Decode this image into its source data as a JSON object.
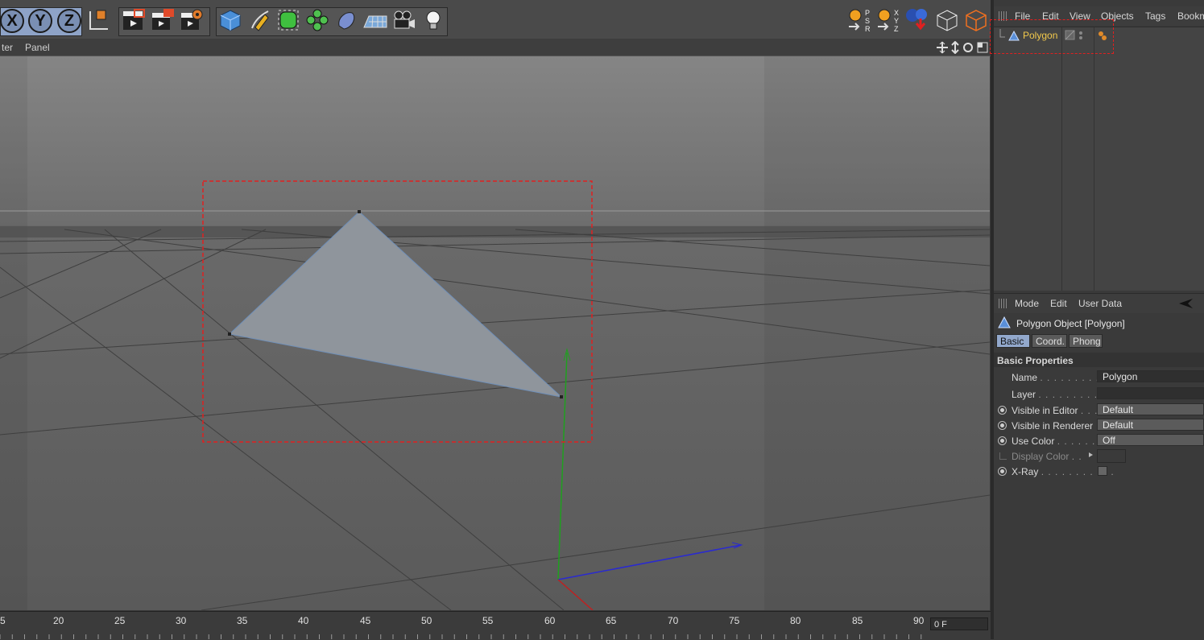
{
  "toolbar": {
    "axis_x": "X",
    "axis_y": "Y",
    "axis_z": "Z",
    "psr_letters": [
      "P",
      "S",
      "R"
    ],
    "xyz_letters": [
      "X",
      "Y",
      "Z"
    ]
  },
  "viewport_menu": {
    "items": [
      "ter",
      "Panel"
    ]
  },
  "object_manager": {
    "menu": [
      "File",
      "Edit",
      "View",
      "Objects",
      "Tags",
      "Bookm"
    ],
    "objects": [
      {
        "name": "Polygon",
        "color": "#f2c94c"
      }
    ]
  },
  "attribute_manager": {
    "menu": [
      "Mode",
      "Edit",
      "User Data"
    ],
    "object_title": "Polygon Object [Polygon]",
    "tabs": [
      {
        "label": "Basic",
        "active": true
      },
      {
        "label": "Coord.",
        "active": false
      },
      {
        "label": "Phong",
        "active": false
      }
    ],
    "section_title": "Basic Properties",
    "properties": {
      "name_label": "Name",
      "name_value": "Polygon",
      "layer_label": "Layer",
      "layer_value": "",
      "vis_editor_label": "Visible in Editor",
      "vis_editor_value": "Default",
      "vis_renderer_label": "Visible in Renderer",
      "vis_renderer_value": "Default",
      "use_color_label": "Use Color",
      "use_color_value": "Off",
      "display_color_label": "Display Color",
      "xray_label": "X-Ray"
    }
  },
  "timeline": {
    "ticks": [
      "5",
      "20",
      "25",
      "30",
      "35",
      "40",
      "45",
      "50",
      "55",
      "60",
      "65",
      "70",
      "75",
      "80",
      "85",
      "90"
    ],
    "current_frame": "0 F"
  },
  "colors": {
    "selection_dashed": "#e02020",
    "y_axis": "#1fa01f",
    "z_axis": "#2a2ad0",
    "x_axis": "#c02020",
    "polygon_fill": "#8f959c",
    "accent_tab": "#92a8cc"
  }
}
